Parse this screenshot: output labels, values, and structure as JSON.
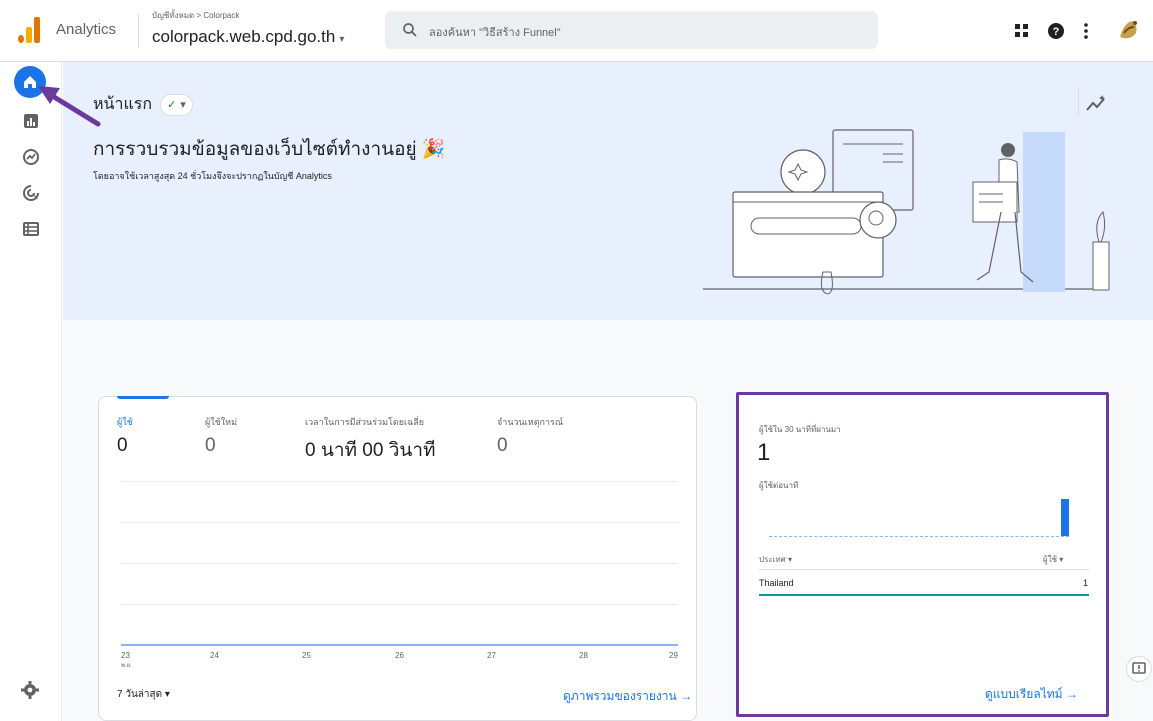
{
  "header": {
    "app_name": "Analytics",
    "breadcrumb": "บัญชีทั้งหมด > Colorpack",
    "property": "colorpack.web.cpd.go.th",
    "property_caret": "▾",
    "search_placeholder": "ลองค้นหา \"วิธีสร้าง Funnel\"",
    "icons": [
      "apps-grid-icon",
      "help-icon",
      "more-vert-icon",
      "account-avatar"
    ]
  },
  "rail": {
    "items": [
      "home-icon",
      "reports-icon",
      "explore-icon",
      "advertising-icon",
      "configure-icon"
    ],
    "settings": "settings-icon"
  },
  "hero": {
    "title": "หน้าแรก",
    "status_chip": "✓",
    "headline": "การรวบรวมข้อมูลของเว็บไซต์ทำงานอยู่ 🎉",
    "subtitle": "โดยอาจใช้เวลาสูงสุด 24 ชั่วโมงจึงจะปรากฏในบัญชี Analytics"
  },
  "overview_card": {
    "metrics": [
      {
        "label": "ผู้ใช้",
        "value": "0",
        "active": true
      },
      {
        "label": "ผู้ใช้ใหม่",
        "value": "0",
        "active": false
      },
      {
        "label": "เวลาในการมีส่วนร่วมโดยเฉลี่ย",
        "value": "0 นาที 00 วินาที",
        "active": false
      },
      {
        "label": "จำนวนเหตุการณ์",
        "value": "0",
        "active": false
      }
    ],
    "x_ticks": [
      "23",
      "24",
      "25",
      "26",
      "27",
      "28",
      "29"
    ],
    "x_tick_sub": "พ.ย.",
    "range_label": "7 วันล่าสุด ▾",
    "link": "ดูภาพรวมของรายงาน →"
  },
  "realtime_card": {
    "title": "ผู้ใช้ใน 30 นาทีที่ผ่านมา",
    "value": "1",
    "subtitle": "ผู้ใช้ต่อนาที",
    "col_country": "ประเทศ ▾",
    "col_users": "ผู้ใช้ ▾",
    "rows": [
      {
        "country": "Thailand",
        "users": "1"
      }
    ],
    "link": "ดูแบบเรียลไทม์ →"
  },
  "colors": {
    "accent": "#1a73e8",
    "hero_bg": "#e8f0fe",
    "annotation": "#6a3a9c"
  }
}
